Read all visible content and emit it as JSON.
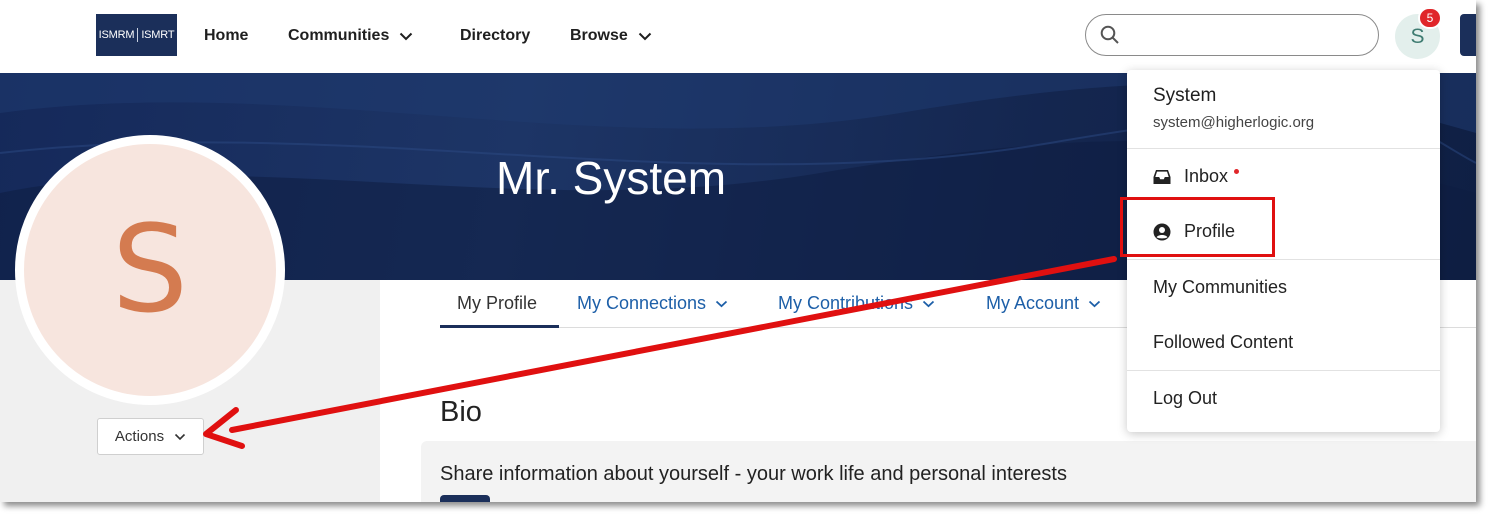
{
  "nav": {
    "logo_left": "ISMRM",
    "logo_right": "ISMRT",
    "home": "Home",
    "communities": "Communities",
    "directory": "Directory",
    "browse": "Browse",
    "search_placeholder": "",
    "avatar_initial": "S",
    "notification_count": "5"
  },
  "hero": {
    "title": "Mr. System"
  },
  "profile": {
    "avatar_initial": "S",
    "actions_label": "Actions"
  },
  "tabs": [
    {
      "label": "My Profile",
      "active": true
    },
    {
      "label": "My Connections"
    },
    {
      "label": "My Contributions"
    },
    {
      "label": "My Account"
    }
  ],
  "bio": {
    "title": "Bio",
    "prompt": "Share information about yourself - your work life and personal interests"
  },
  "menu": {
    "name": "System",
    "email": "system@higherlogic.org",
    "items": [
      {
        "label": "Inbox",
        "icon": "inbox-icon"
      },
      {
        "label": "Profile",
        "icon": "user-circle-icon"
      },
      {
        "label": "My Communities"
      },
      {
        "label": "Followed Content"
      },
      {
        "label": "Log Out"
      }
    ]
  },
  "colors": {
    "brand_navy": "#1b2f5a",
    "link_blue": "#1d5fa8",
    "annotation_red": "#e01010",
    "badge_red": "#e0262a"
  }
}
